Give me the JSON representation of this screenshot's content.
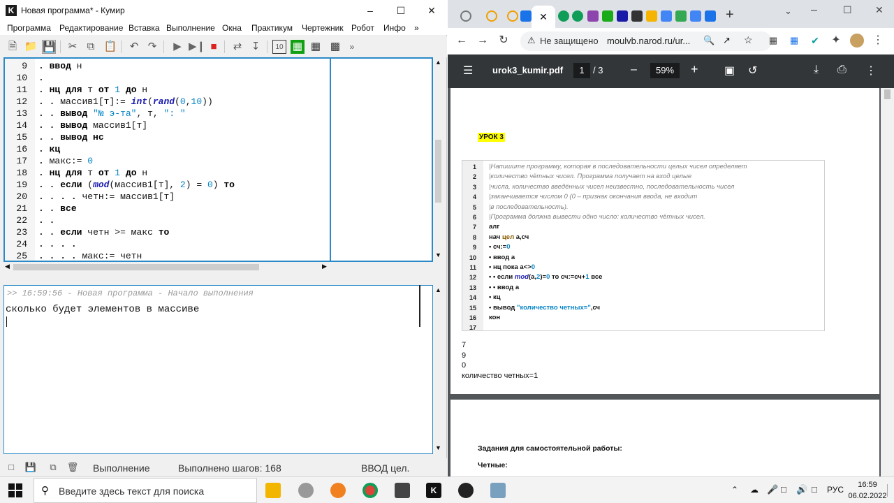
{
  "kumir": {
    "title": "Новая программа* - Кумир",
    "logo": "K",
    "menu": [
      "Программа",
      "Редактирование",
      "Вставка",
      "Выполнение",
      "Окна",
      "Практикум",
      "Чертежник",
      "Робот",
      "Инфо",
      "»"
    ],
    "toolbar_more": "»",
    "line_numbers": [
      "9",
      "10",
      "11",
      "12",
      "13",
      "14",
      "15",
      "16",
      "17",
      "18",
      "19",
      "20",
      "21",
      "22",
      "23",
      "24",
      "25"
    ],
    "console": {
      "log": ">> 16:59:56 - Новая программа - Начало выполнения",
      "output": "сколько будет элементов в массиве"
    },
    "status": {
      "mode": "Выполнение",
      "steps": "Выполнено шагов: 168",
      "input": "ВВОД цел."
    }
  },
  "browser": {
    "address_warning": "Не защищено",
    "address_url": "moulvb.narod.ru/ur...",
    "pdf": {
      "file_name": "urok3_kumir.pdf",
      "page": "1",
      "page_total": "/ 3",
      "zoom": "59%",
      "lesson_label": "УРОК 3",
      "snippet_line_numbers": [
        "1",
        "2",
        "3",
        "4",
        "5",
        "6",
        "7",
        "8",
        "9",
        "10",
        "11",
        "12",
        "13",
        "14",
        "15",
        "16",
        "17"
      ],
      "output_values": [
        "7",
        "9",
        "0",
        "количество четных=1"
      ],
      "page2_heading": "Задания для самостоятельной работы:",
      "page2_sub": "Четные:"
    }
  },
  "taskbar": {
    "search_placeholder": "Введите здесь текст для поиска",
    "language": "РУС",
    "time": "16:59",
    "date": "06.02.2022"
  },
  "colors": {
    "accent_blue": "#2a8ac8",
    "keyword_number": "#0a86c8",
    "pdf_toolbar": "#323639",
    "lesson_highlight": "#ffff00"
  }
}
